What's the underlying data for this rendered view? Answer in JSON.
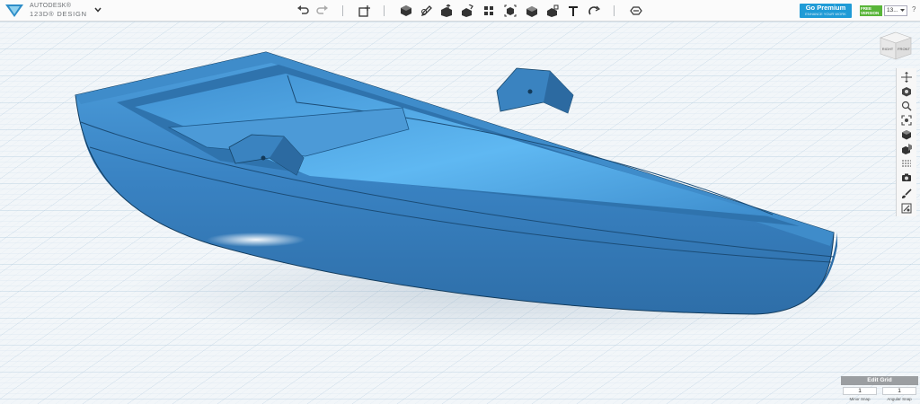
{
  "app": {
    "brand_line1": "AUTODESK®",
    "brand_line2": "123D® DESIGN"
  },
  "toolbar": {
    "tools": [
      "undo",
      "redo",
      "transform",
      "primitives",
      "sketch",
      "construct",
      "modify",
      "pattern",
      "grouping",
      "combine",
      "measure",
      "snap",
      "text",
      "material"
    ],
    "premium_label": "Go Premium",
    "premium_sub": "ENHANCE YOUR WORK",
    "free_version_label": "FREE VERSION",
    "user_label": "13...",
    "help_label": "?"
  },
  "viewcube": {
    "left_face": "RIGHT",
    "right_face": "FRONT"
  },
  "right_tools": [
    "pan",
    "orbit",
    "zoom",
    "fit",
    "views",
    "visibility",
    "materials",
    "screenshot",
    "paint",
    "grid-settings"
  ],
  "edit_grid": {
    "title": "Edit Grid",
    "minor_snap_value": "1",
    "angle_snap_value": "1",
    "minor_snap_label": "Minor Snap",
    "angle_snap_label": "Angular Snap"
  },
  "colors": {
    "accent": "#1f9bd6",
    "model": "#3b86c5",
    "grid_major": "#b8cfe0",
    "free_badge": "#58b538"
  }
}
